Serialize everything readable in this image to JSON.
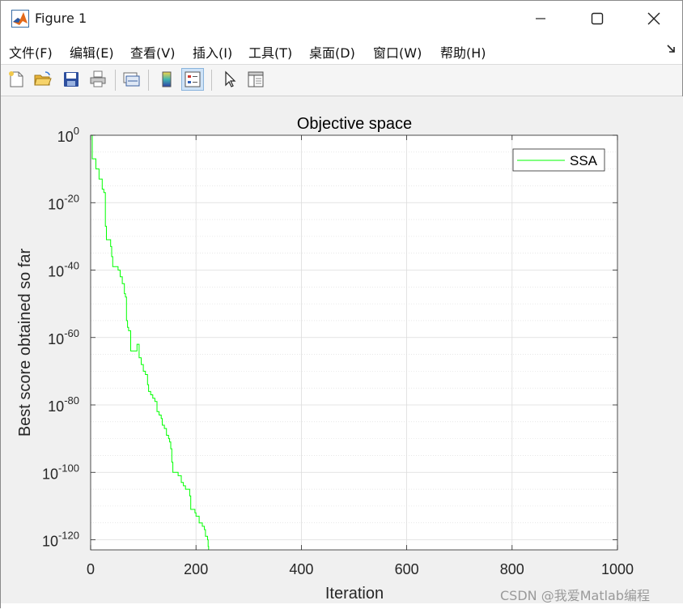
{
  "window": {
    "title": "Figure 1",
    "icon": "matlab-icon",
    "controls": [
      "minimize-icon",
      "maximize-icon",
      "close-icon"
    ]
  },
  "menu": {
    "items": [
      {
        "label": "文件(F)"
      },
      {
        "label": "编辑(E)"
      },
      {
        "label": "查看(V)"
      },
      {
        "label": "插入(I)"
      },
      {
        "label": "工具(T)"
      },
      {
        "label": "桌面(D)"
      },
      {
        "label": "窗口(W)"
      },
      {
        "label": "帮助(H)"
      }
    ],
    "dock_icon": "dock-arrow-icon"
  },
  "toolbar": {
    "buttons": [
      {
        "icon": "new-file-icon"
      },
      {
        "icon": "open-folder-icon"
      },
      {
        "icon": "save-icon"
      },
      {
        "icon": "print-icon"
      },
      {
        "icon": "link-plot-icon"
      },
      {
        "icon": "colorbar-icon"
      },
      {
        "icon": "legend-icon",
        "active": true
      },
      {
        "icon": "pointer-icon"
      },
      {
        "icon": "property-editor-icon"
      }
    ]
  },
  "chart_data": {
    "type": "line",
    "title": "Objective space",
    "xlabel": "Iteration",
    "ylabel": "Best score obtained so far",
    "xlim": [
      0,
      1000
    ],
    "ylim_exponent": [
      -123,
      0
    ],
    "yscale": "log",
    "xticks": [
      "0",
      "200",
      "400",
      "600",
      "800",
      "1000"
    ],
    "yticks": [
      {
        "base": "10",
        "exp": "0",
        "value": 0
      },
      {
        "base": "10",
        "exp": "-20",
        "value": -20
      },
      {
        "base": "10",
        "exp": "-40",
        "value": -40
      },
      {
        "base": "10",
        "exp": "-60",
        "value": -60
      },
      {
        "base": "10",
        "exp": "-80",
        "value": -80
      },
      {
        "base": "10",
        "exp": "-100",
        "value": -100
      },
      {
        "base": "10",
        "exp": "-120",
        "value": -120
      }
    ],
    "grid": true,
    "legend_position": "top-right",
    "series": [
      {
        "name": "SSA",
        "color": "#00ff00",
        "points": [
          [
            1,
            0
          ],
          [
            3,
            -7
          ],
          [
            5,
            -7
          ],
          [
            8,
            -7
          ],
          [
            10,
            -10
          ],
          [
            14,
            -10
          ],
          [
            16,
            -13
          ],
          [
            20,
            -13
          ],
          [
            22,
            -16
          ],
          [
            24,
            -16
          ],
          [
            25,
            -17
          ],
          [
            27,
            -17
          ],
          [
            28,
            -27
          ],
          [
            30,
            -31
          ],
          [
            36,
            -31
          ],
          [
            38,
            -33
          ],
          [
            40,
            -36
          ],
          [
            42,
            -39
          ],
          [
            52,
            -40
          ],
          [
            56,
            -42
          ],
          [
            60,
            -44
          ],
          [
            64,
            -47
          ],
          [
            66,
            -48
          ],
          [
            68,
            -55
          ],
          [
            70,
            -57
          ],
          [
            72,
            -58
          ],
          [
            74,
            -58
          ],
          [
            76,
            -64
          ],
          [
            82,
            -64
          ],
          [
            88,
            -62
          ],
          [
            92,
            -66
          ],
          [
            96,
            -68
          ],
          [
            100,
            -70
          ],
          [
            104,
            -71
          ],
          [
            108,
            -74
          ],
          [
            110,
            -76
          ],
          [
            114,
            -77
          ],
          [
            118,
            -78
          ],
          [
            122,
            -79
          ],
          [
            126,
            -82
          ],
          [
            130,
            -83
          ],
          [
            134,
            -84
          ],
          [
            136,
            -86
          ],
          [
            140,
            -87
          ],
          [
            144,
            -89
          ],
          [
            148,
            -90
          ],
          [
            150,
            -91
          ],
          [
            152,
            -93
          ],
          [
            154,
            -97
          ],
          [
            156,
            -100
          ],
          [
            166,
            -101
          ],
          [
            172,
            -103
          ],
          [
            176,
            -104
          ],
          [
            180,
            -105
          ],
          [
            186,
            -105
          ],
          [
            188,
            -107
          ],
          [
            190,
            -111
          ],
          [
            196,
            -111
          ],
          [
            198,
            -112
          ],
          [
            200,
            -113
          ],
          [
            204,
            -113
          ],
          [
            206,
            -115
          ],
          [
            212,
            -116
          ],
          [
            216,
            -117
          ],
          [
            218,
            -119
          ],
          [
            220,
            -119
          ],
          [
            222,
            -120
          ],
          [
            223,
            -122
          ],
          [
            224,
            -123
          ]
        ]
      }
    ]
  },
  "watermark": "CSDN @我爱Matlab编程"
}
